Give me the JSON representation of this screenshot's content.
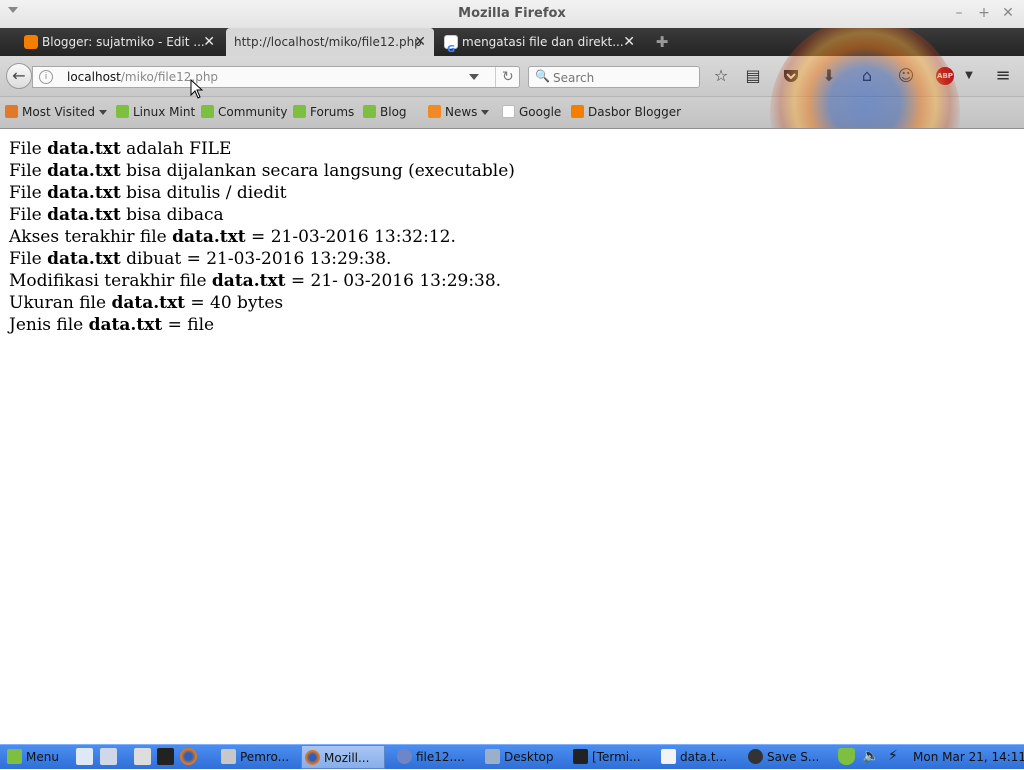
{
  "window": {
    "title": "Mozilla Firefox"
  },
  "tabs": [
    {
      "label": "Blogger: sujatmiko - Edit ...",
      "favicon": "blogger-icon",
      "active": false
    },
    {
      "label": "http://localhost/miko/file12.php",
      "favicon": "none",
      "active": true
    },
    {
      "label": "mengatasi file dan direkt...",
      "favicon": "google-icon",
      "active": false
    }
  ],
  "tab_close_glyph": "✕",
  "navbar": {
    "url_host": "localhost",
    "url_path": "/miko/file12.php",
    "search_placeholder": "Search"
  },
  "bookmarks": [
    {
      "label": "Most Visited",
      "icon": "most-visited-icon",
      "dropdown": true
    },
    {
      "label": "Linux Mint",
      "icon": "linux-mint-icon",
      "dropdown": false
    },
    {
      "label": "Community",
      "icon": "linux-mint-icon",
      "dropdown": false
    },
    {
      "label": "Forums",
      "icon": "linux-mint-icon",
      "dropdown": false
    },
    {
      "label": "Blog",
      "icon": "linux-mint-icon",
      "dropdown": false
    },
    {
      "label": "News",
      "icon": "rss-icon",
      "dropdown": true
    },
    {
      "label": "Google",
      "icon": "google-icon",
      "dropdown": false
    },
    {
      "label": "Dasbor Blogger",
      "icon": "blogger-icon",
      "dropdown": false
    }
  ],
  "content": {
    "filename": "data.txt",
    "lines": [
      {
        "pre": "File ",
        "post": " adalah FILE"
      },
      {
        "pre": "File ",
        "post": " bisa dijalankan secara langsung (executable)"
      },
      {
        "pre": "File ",
        "post": " bisa ditulis / diedit"
      },
      {
        "pre": "File ",
        "post": " bisa dibaca"
      },
      {
        "pre": "Akses terakhir file ",
        "post": " = 21-03-2016 13:32:12."
      },
      {
        "pre": "File ",
        "post": " dibuat = 21-03-2016 13:29:38."
      },
      {
        "pre": "Modifikasi terakhir file ",
        "post": " = 21- 03-2016 13:29:38."
      },
      {
        "pre": "Ukuran file ",
        "post": " = 40 bytes"
      },
      {
        "pre": "Jenis file ",
        "post": " = file"
      }
    ]
  },
  "taskbar": {
    "menu_label": "Menu",
    "tasks": [
      {
        "label": "Pemro...",
        "icon": "document-icon",
        "active": false
      },
      {
        "label": "Mozill...",
        "icon": "firefox-icon",
        "active": true
      },
      {
        "label": "file12....",
        "icon": "php-file-icon",
        "active": false
      },
      {
        "label": "Desktop",
        "icon": "folder-icon",
        "active": false
      },
      {
        "label": "[Termi...",
        "icon": "terminal-icon",
        "active": false
      },
      {
        "label": "data.t...",
        "icon": "text-editor-icon",
        "active": false
      },
      {
        "label": "Save S...",
        "icon": "screenshot-icon",
        "active": false
      }
    ],
    "clock": "Mon Mar 21, 14:11"
  },
  "colors": {
    "taskbar": "#3a7de6",
    "tabstrip": "#2e2e2e",
    "toolbar": "#d0d0d0",
    "mint_green": "#7fbf3f"
  }
}
